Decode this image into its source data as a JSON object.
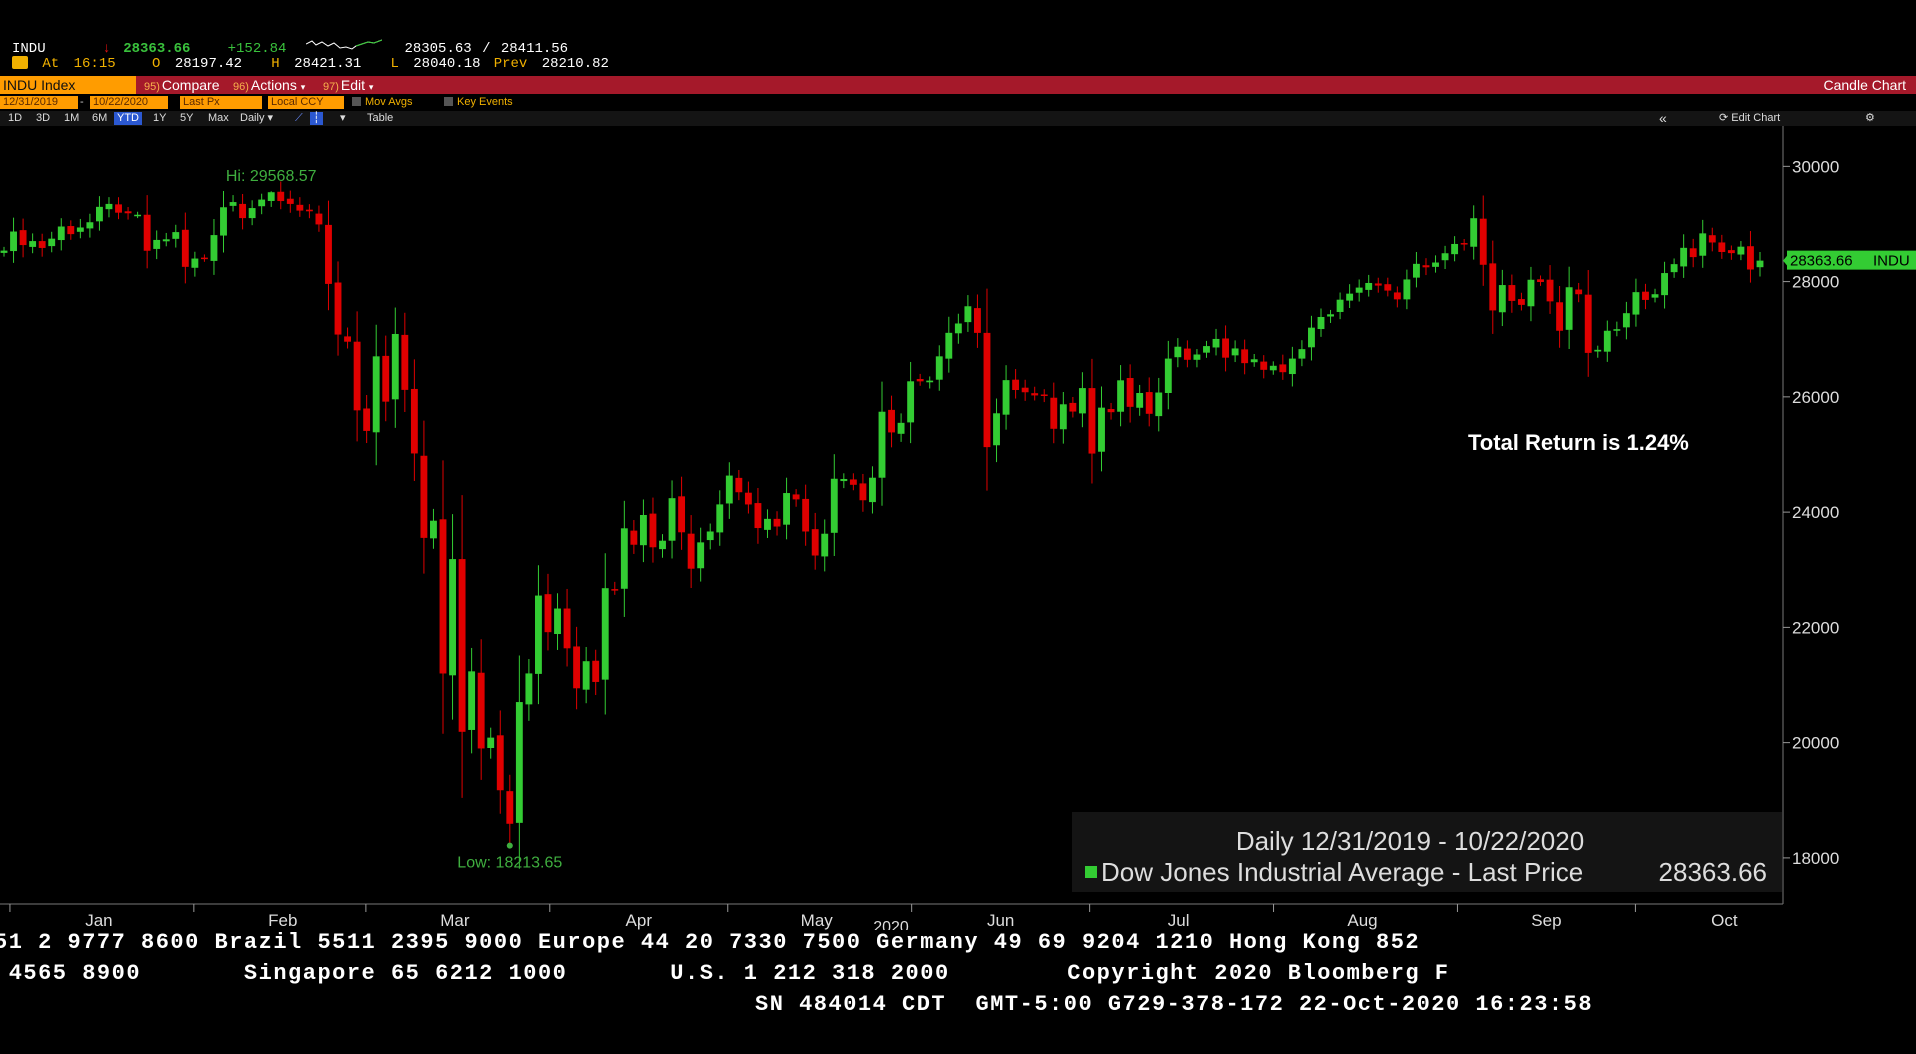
{
  "quote": {
    "ticker": "INDU",
    "arrow": "↓",
    "last": "28363.66",
    "change": "+152.84",
    "range_low": "28305.63",
    "range_sep": "/",
    "range_high": "28411.56",
    "at_label": "At",
    "time": "16:15",
    "open_label": "O",
    "open": "28197.42",
    "high_label": "H",
    "high": "28421.31",
    "low_label": "L",
    "low": "28040.18",
    "prev_label": "Prev",
    "prev": "28210.82"
  },
  "menubar": {
    "security": "INDU Index",
    "compare_num": "95)",
    "compare": "Compare",
    "actions_num": "96)",
    "actions": "Actions",
    "edit_num": "97)",
    "edit": "Edit",
    "chart_type": "Candle Chart"
  },
  "params": {
    "start_date": "12/31/2019",
    "dash": "-",
    "end_date": "10/22/2020",
    "price_field": "Last Px",
    "currency": "Local CCY",
    "mov_avgs": "Mov Avgs",
    "key_events": "Key Events"
  },
  "ranges": {
    "items": [
      "1D",
      "3D",
      "1M",
      "6M",
      "YTD",
      "1Y",
      "5Y",
      "Max"
    ],
    "selected": "YTD",
    "period": "Daily",
    "table": "Table",
    "edit_chart": "Edit Chart"
  },
  "colors": {
    "up": "#33cc33",
    "down": "#e00000",
    "menubar": "#a5192a",
    "amber": "#ff9c00",
    "hi_low_label": "#3fae3f"
  },
  "icons": [
    "line-chart-icon",
    "candle-icon",
    "collapse-icon",
    "settings-icon"
  ],
  "chart_data": {
    "type": "candlestick",
    "title": "Total Return is 1.24%",
    "legend_title": "Daily 12/31/2019 - 10/22/2020",
    "legend_series": "Dow Jones Industrial Average - Last Price",
    "legend_value": "28363.66",
    "last_price_tag": "28363.66",
    "last_price_tag_suffix": "INDU",
    "hi_label": "Hi: 29568.57",
    "low_label": "Low: 18213.65",
    "hi_value": 29568.57,
    "low_value": 18213.65,
    "year_label": "2020",
    "x_months": [
      "Jan",
      "Feb",
      "Mar",
      "Apr",
      "May",
      "Jun",
      "Jul",
      "Aug",
      "Sep",
      "Oct"
    ],
    "y_ticks": [
      18000,
      20000,
      22000,
      24000,
      26000,
      28000,
      30000
    ],
    "ylim": [
      17200,
      30700
    ],
    "dates": [
      "2019-12-31",
      "2020-10-22"
    ],
    "closes": [
      28538,
      28869,
      28634,
      28703,
      28584,
      28745,
      28956,
      28824,
      28939,
      29030,
      29297,
      29348,
      29196,
      29186,
      29160,
      28535,
      28723,
      28734,
      28859,
      28256,
      28400,
      28399,
      28807,
      29290,
      29380,
      29102,
      29276,
      29423,
      29551,
      29398,
      29348,
      29232,
      29220,
      28992,
      27960,
      27081,
      26957,
      25766,
      25409,
      26703,
      25917,
      27091,
      26121,
      25018,
      23553,
      23851,
      21200,
      23185,
      20188,
      21237,
      19899,
      20087,
      19174,
      18592,
      20704,
      21201,
      22552,
      21917,
      22327,
      21637,
      20943,
      21413,
      21053,
      22680,
      22654,
      23719,
      23434,
      23950,
      23390,
      23504,
      24242,
      23650,
      23018,
      23475,
      23664,
      24134,
      24634,
      24345,
      24133,
      23724,
      23883,
      23750,
      24331,
      24221,
      23664,
      23247,
      23625,
      24579,
      24575,
      24474,
      24206,
      24597,
      25742,
      25383,
      25549,
      26270,
      26269,
      26282,
      26703,
      27111,
      27273,
      27572,
      27110,
      25128,
      25715,
      26290,
      26119,
      26080,
      26025,
      26025,
      25446,
      25871,
      25745,
      26152,
      25016,
      25813,
      25734,
      26287,
      25827,
      26067,
      25706,
      26075,
      26664,
      26870,
      26643,
      26735,
      26881,
      27005,
      26680,
      26840,
      26585,
      26652,
      26469,
      26539,
      26428,
      26664,
      26828,
      27201,
      27386,
      27433,
      27686,
      27791,
      27896,
      27976,
      27931,
      27844,
      27692,
      28037,
      28308,
      28248,
      28331,
      28492,
      28653,
      28645,
      29100,
      28292,
      27500,
      27940,
      27665,
      27596,
      28032,
      27993,
      27657,
      27147,
      27902,
      27781,
      26763,
      26816,
      27147,
      27174,
      27452,
      27817,
      27682,
      27781,
      28148,
      28303,
      28586,
      28425,
      28837,
      28679,
      28514,
      28494,
      28606,
      28210,
      28364
    ]
  },
  "ticker": {
    "line1": "51 2 9777 8600 Brazil 5511 2395 9000 Europe 44 20 7330 7500 Germany 49 69 9204 1210 Hong Kong 852",
    "line2": " 4565 8900       Singapore 65 6212 1000       U.S. 1 212 318 2000        Copyright 2020 Bloomberg F",
    "line3": "SN 484014 CDT  GMT-5:00 G729-378-172 22-Oct-2020 16:23:58"
  }
}
